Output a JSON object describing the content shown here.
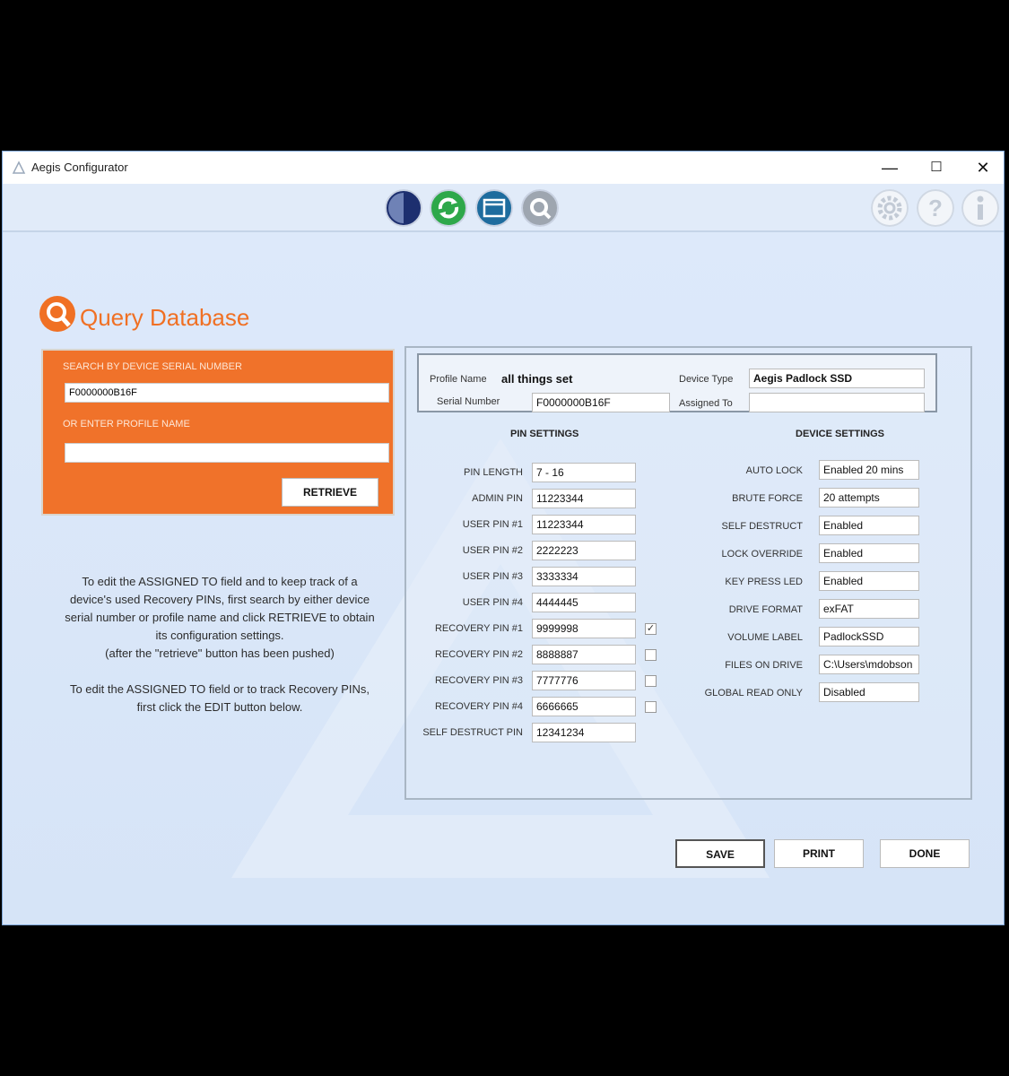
{
  "window": {
    "title": "Aegis Configurator",
    "minimize": "—",
    "maximize": "☐",
    "close": "✕"
  },
  "toolbar": {
    "icons": [
      "device-icon",
      "sync-icon",
      "database-icon",
      "query-icon"
    ],
    "right_icons": [
      "gear-icon",
      "help-icon",
      "info-icon"
    ]
  },
  "page": {
    "title": "Query Database"
  },
  "search": {
    "serial_label": "SEARCH BY DEVICE SERIAL NUMBER",
    "serial_value": "F0000000B16F",
    "profile_label": "OR ENTER PROFILE NAME",
    "profile_value": "",
    "retrieve_label": "RETRIEVE"
  },
  "help_text": "To edit the ASSIGNED TO field and to keep track of a\ndevice's used Recovery PINs, first search by either device\nserial number or profile name and click RETRIEVE to obtain\nits configuration settings.\n(after the \"retrieve\" button has been pushed)\n\nTo edit the ASSIGNED TO field or to track Recovery PINs,\nfirst click the EDIT button below.",
  "profile": {
    "profile_name_label": "Profile Name",
    "profile_name_value": "all things set",
    "serial_label": "Serial Number",
    "serial_value": "F0000000B16F",
    "device_type_label": "Device Type",
    "device_type_value": "Aegis Padlock SSD",
    "assigned_to_label": "Assigned To",
    "assigned_to_value": ""
  },
  "pin_settings": {
    "title": "PIN SETTINGS",
    "rows": [
      {
        "label": "PIN LENGTH",
        "value": "7 - 16"
      },
      {
        "label": "ADMIN PIN",
        "value": "11223344"
      },
      {
        "label": "USER PIN #1",
        "value": "11223344"
      },
      {
        "label": "USER PIN #2",
        "value": "2222223"
      },
      {
        "label": "USER PIN #3",
        "value": "3333334"
      },
      {
        "label": "USER PIN #4",
        "value": "4444445"
      },
      {
        "label": "RECOVERY PIN #1",
        "value": "9999998",
        "check": "✓"
      },
      {
        "label": "RECOVERY PIN #2",
        "value": "8888887",
        "check": ""
      },
      {
        "label": "RECOVERY PIN #3",
        "value": "7777776",
        "check": ""
      },
      {
        "label": "RECOVERY PIN #4",
        "value": "6666665",
        "check": ""
      },
      {
        "label": "SELF DESTRUCT PIN",
        "value": "12341234"
      }
    ]
  },
  "device_settings": {
    "title": "DEVICE SETTINGS",
    "rows": [
      {
        "label": "AUTO LOCK",
        "value": "Enabled 20 mins"
      },
      {
        "label": "BRUTE FORCE",
        "value": "20 attempts"
      },
      {
        "label": "SELF DESTRUCT",
        "value": "Enabled"
      },
      {
        "label": "LOCK OVERRIDE",
        "value": "Enabled"
      },
      {
        "label": "KEY PRESS LED",
        "value": "Enabled"
      },
      {
        "label": "DRIVE FORMAT",
        "value": "exFAT"
      },
      {
        "label": "VOLUME LABEL",
        "value": "PadlockSSD"
      },
      {
        "label": "FILES ON DRIVE",
        "value": "C:\\Users\\mdobson"
      },
      {
        "label": "GLOBAL READ ONLY",
        "value": "Disabled"
      }
    ]
  },
  "buttons": {
    "save": "SAVE",
    "print": "PRINT",
    "done": "DONE"
  },
  "colors": {
    "accent": "#f07024",
    "window_bg": "#dbe7f8"
  }
}
